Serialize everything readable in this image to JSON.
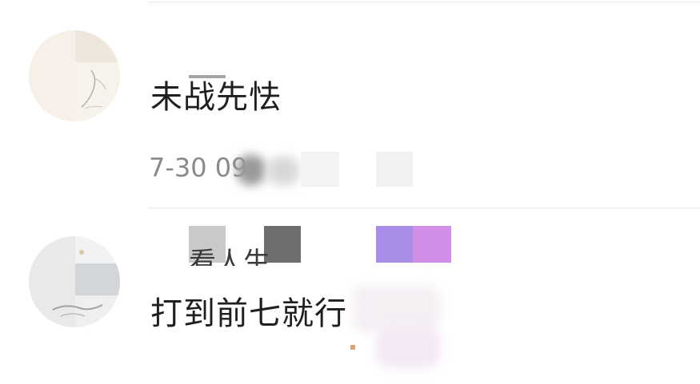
{
  "comments": [
    {
      "text": "未战先怯",
      "time": "7-30 09"
    },
    {
      "text": "打到前七就行",
      "username": "看人生"
    }
  ],
  "colors": {
    "text": "#1f1f1f",
    "timestamp": "#8a8a8a",
    "divider": "#e6e6e6",
    "mosaic_purple": "#a98be8",
    "mosaic_pink": "#d08ee6"
  },
  "icons": [
    "avatar-sketch-icon"
  ]
}
